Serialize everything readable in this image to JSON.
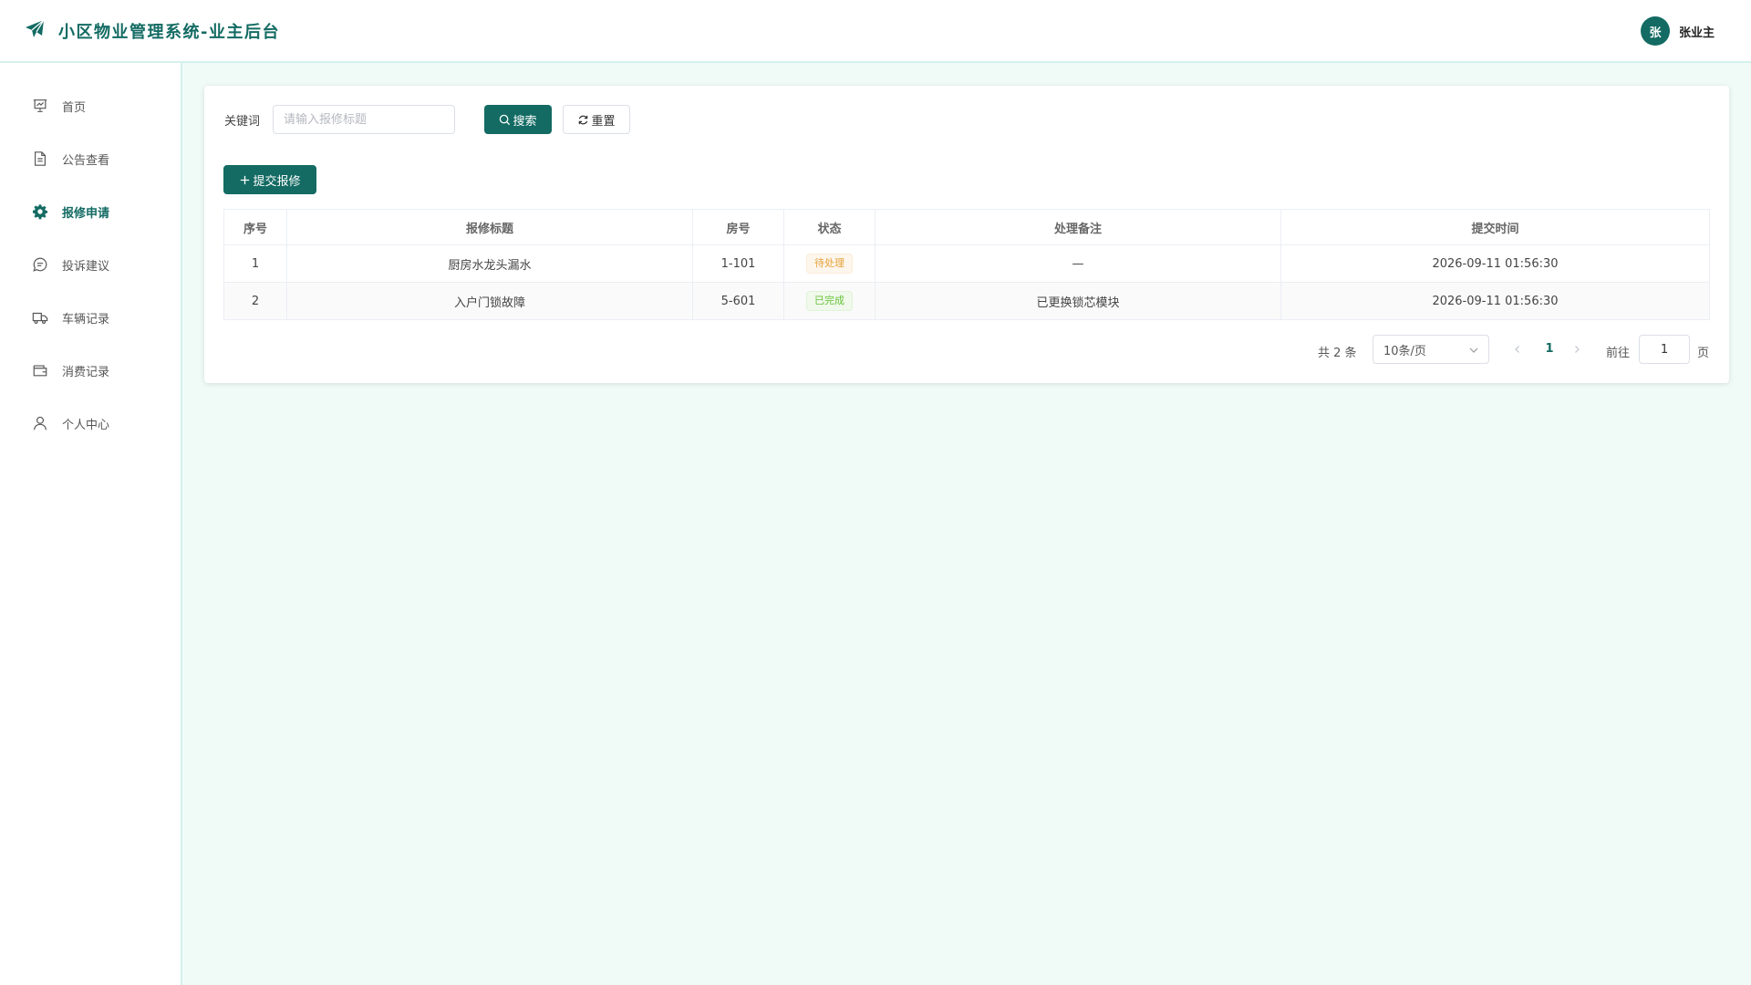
{
  "header": {
    "title": "小区物业管理系统-业主后台",
    "user": {
      "avatar_text": "张",
      "name": "张业主"
    }
  },
  "sidebar": {
    "items": [
      {
        "label": "首页",
        "icon": "presentation-icon",
        "active": false
      },
      {
        "label": "公告查看",
        "icon": "document-icon",
        "active": false
      },
      {
        "label": "报修申请",
        "icon": "gear-icon",
        "active": true
      },
      {
        "label": "投诉建议",
        "icon": "chat-bubble-icon",
        "active": false
      },
      {
        "label": "车辆记录",
        "icon": "truck-icon",
        "active": false
      },
      {
        "label": "消费记录",
        "icon": "wallet-icon",
        "active": false
      },
      {
        "label": "个人中心",
        "icon": "user-icon",
        "active": false
      }
    ]
  },
  "filter": {
    "keyword_label": "关键词",
    "keyword_value": "",
    "keyword_placeholder": "请输入报修标题",
    "search_label": "搜索",
    "reset_label": "重置"
  },
  "toolbar": {
    "submit_label": "提交报修"
  },
  "table": {
    "columns": [
      "序号",
      "报修标题",
      "房号",
      "状态",
      "处理备注",
      "提交时间"
    ],
    "rows": [
      {
        "index": "1",
        "title": "厨房水龙头漏水",
        "room": "1-101",
        "status": "待处理",
        "status_type": "warning",
        "note": "—",
        "time": "2026-09-11 01:56:30"
      },
      {
        "index": "2",
        "title": "入户门锁故障",
        "room": "5-601",
        "status": "已完成",
        "status_type": "success",
        "note": "已更换锁芯模块",
        "time": "2026-09-11 01:56:30"
      }
    ]
  },
  "pagination": {
    "total_text": "共 2 条",
    "page_size": "10条/页",
    "current_page": "1",
    "goto_label": "前往",
    "goto_value": "1",
    "page_suffix": "页"
  },
  "colors": {
    "primary": "#136b63",
    "background": "#f0fbf8",
    "warning": "#e6a23c",
    "success": "#67c23a"
  }
}
